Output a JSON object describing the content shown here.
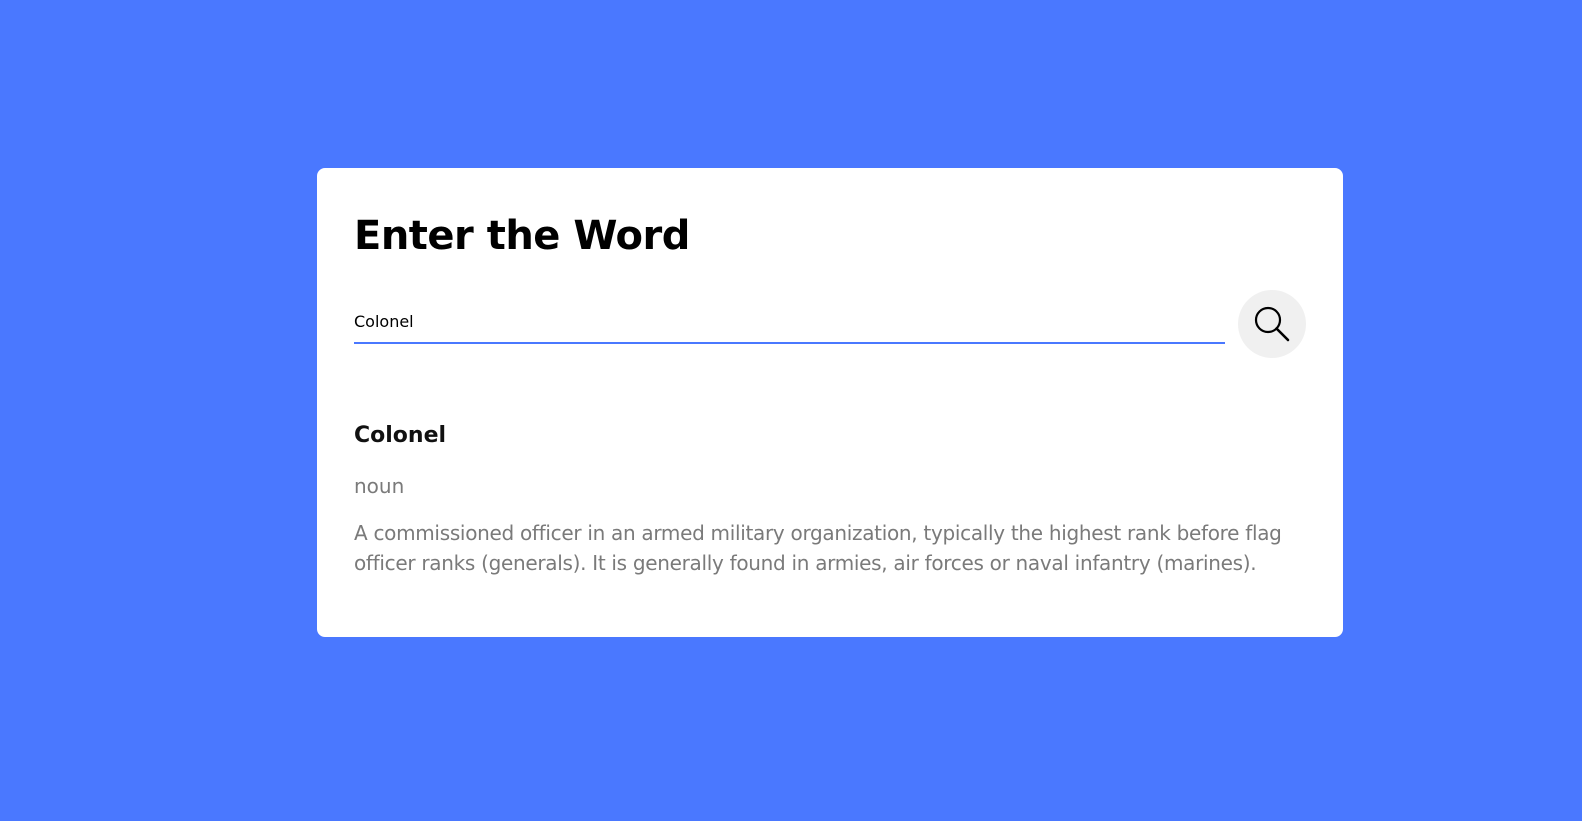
{
  "header": {
    "title": "Enter the Word"
  },
  "search": {
    "value": "Colonel",
    "icon": "search-icon"
  },
  "result": {
    "word": "Colonel",
    "part_of_speech": "noun",
    "definition": "A commissioned officer in an armed military organization, typically the highest rank before flag officer ranks (generals). It is generally found in armies, air forces or naval infantry (marines)."
  },
  "colors": {
    "background": "#4a78ff",
    "card": "#ffffff",
    "accent": "#4a78ff",
    "muted_text": "#7a7a7a",
    "search_button_bg": "#f0f0f0"
  }
}
